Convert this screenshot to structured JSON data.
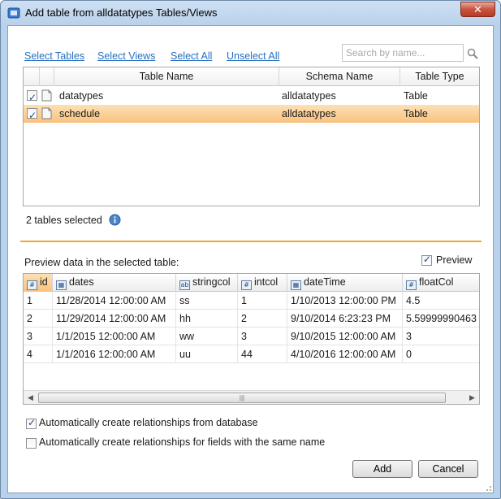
{
  "window": {
    "title": "Add table from alldatatypes Tables/Views",
    "close_label": "✕"
  },
  "links": [
    "Select Tables",
    "Select Views",
    "Select All",
    "Unselect All"
  ],
  "search": {
    "placeholder": "Search by name..."
  },
  "table_list": {
    "headers": [
      "Table Name",
      "Schema Name",
      "Table Type"
    ],
    "rows": [
      {
        "checked": true,
        "name": "datatypes",
        "schema": "alldatatypes",
        "type": "Table",
        "selected": false
      },
      {
        "checked": true,
        "name": "schedule",
        "schema": "alldatatypes",
        "type": "Table",
        "selected": true
      }
    ]
  },
  "summary": "2 tables selected",
  "preview": {
    "label": "Preview data in the selected table:",
    "checkbox_label": "Preview",
    "checked": true
  },
  "grid": {
    "columns": [
      {
        "name": "id",
        "icon": "#"
      },
      {
        "name": "dates",
        "icon": "▦"
      },
      {
        "name": "stringcol",
        "icon": "ab"
      },
      {
        "name": "intcol",
        "icon": "#"
      },
      {
        "name": "dateTime",
        "icon": "▦"
      },
      {
        "name": "floatCol",
        "icon": "#"
      }
    ],
    "rows": [
      [
        "1",
        "11/28/2014 12:00:00 AM",
        "ss",
        "1",
        "1/10/2013 12:00:00 PM",
        "4.5"
      ],
      [
        "2",
        "11/29/2014 12:00:00 AM",
        "hh",
        "2",
        "9/10/2014 6:23:23 PM",
        "5.59999990463"
      ],
      [
        "3",
        "1/1/2015 12:00:00 AM",
        "ww",
        "3",
        "9/10/2015 12:00:00 AM",
        "3"
      ],
      [
        "4",
        "1/1/2016 12:00:00 AM",
        "uu",
        "44",
        "4/10/2016 12:00:00 AM",
        "0"
      ]
    ]
  },
  "options": [
    {
      "label": "Automatically create relationships from database",
      "checked": true
    },
    {
      "label": "Automatically create relationships for fields with the same name",
      "checked": false
    }
  ],
  "buttons": {
    "add": "Add",
    "cancel": "Cancel"
  }
}
